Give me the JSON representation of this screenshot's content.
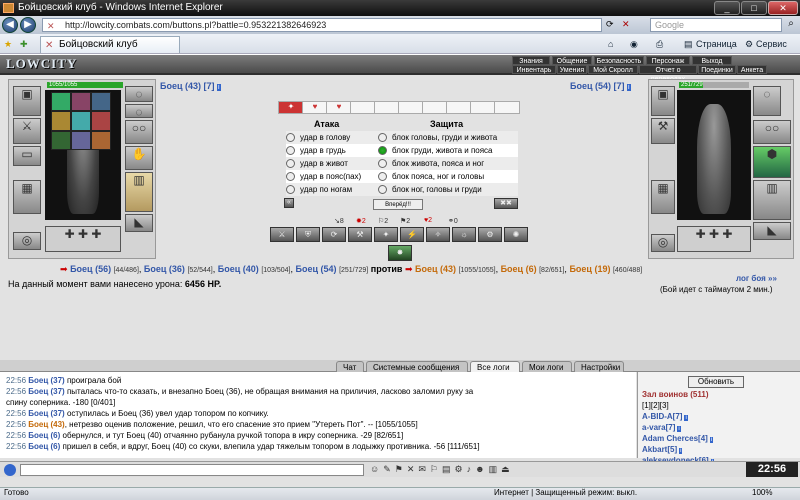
{
  "window": {
    "title": "Бойцовский клуб - Windows Internet Explorer"
  },
  "addressbar": {
    "url": "http://lowcity.combats.com/buttons.pl?battle=0.953221382646923",
    "search_placeholder": "Google"
  },
  "browser_tab": {
    "title": "Бойцовский клуб"
  },
  "commandbar": {
    "page_label": "Страница",
    "tools_label": "Сервис"
  },
  "game_header": {
    "logo": "LOWCITY",
    "menu_top": [
      "Знания",
      "Общение",
      "Безопасность",
      "Персонаж",
      "Выход"
    ],
    "menu_bottom": [
      "Инвентарь",
      "Умения",
      "Мой Скролл",
      "Отчет о переводах",
      "Поединки",
      "Анкета"
    ]
  },
  "player_left": {
    "name": "Боец (43) [7]",
    "hp": "1055/1055"
  },
  "player_right": {
    "name": "Боец (54) [7]",
    "hp": "251/729"
  },
  "combat": {
    "attack_title": "Атака",
    "defense_title": "Защита",
    "attacks": [
      "удар в голову",
      "удар в грудь",
      "удар в живот",
      "удар в пояс(пах)",
      "удар по ногам"
    ],
    "defenses": [
      "блок головы, груди и живота",
      "блок груди, живота и пояса",
      "блок живота, пояса и ног",
      "блок пояса, ног и головы",
      "блок ног, головы и груди"
    ],
    "selected_defense": 1,
    "submit_label": "Вперёд!!!",
    "stats": [
      "8",
      "2",
      "2",
      "2",
      "2",
      "0"
    ]
  },
  "teams": {
    "left": [
      {
        "name": "Боец (56)",
        "hp": "[44/486]"
      },
      {
        "name": "Боец (36)",
        "hp": "[52/544]"
      },
      {
        "name": "Боец (40)",
        "hp": "[103/504]"
      },
      {
        "name": "Боец (54)",
        "hp": "[251/729]"
      }
    ],
    "vs_label": "против",
    "right": [
      {
        "name": "Боец (43)",
        "hp": "[1055/1055]"
      },
      {
        "name": "Боец (6)",
        "hp": "[82/651]"
      },
      {
        "name": "Боец (19)",
        "hp": "[460/488]"
      }
    ]
  },
  "damage_text": "На данный момент вами нанесено урона:",
  "damage_value": "6456 HP.",
  "log_link": "лог боя »»",
  "timeout_text": "(Бой идет с таймаутом 2 мин.)",
  "chat_tabs": [
    "Чат",
    "Системные сообщения",
    "Все логи",
    "Мои логи",
    "Настройки"
  ],
  "chat_log": [
    {
      "time": "22:56",
      "html_a": "Боец (37)",
      "text": " проиграла бой"
    },
    {
      "time": "22:56",
      "html_a": "Боец (37)",
      "text": " пыталась что-то сказать, и внезапно Боец (36), не обращая внимания на приличия, ласково заломил руку за"
    },
    {
      "time": "",
      "html_a": "",
      "text": "спину соперника. -180 [0/401]"
    },
    {
      "time": "22:56",
      "html_a": "Боец (37)",
      "text": " оступилась и Боец (36) увел удар топором по копчику."
    },
    {
      "time": "22:56",
      "html_a": "Боец (43)",
      "text": ", нетрезво оценив положение, решил, что его спасение это прием \"Утереть Пот\". -- [1055/1055]"
    },
    {
      "time": "22:56",
      "html_a": "Боец (6)",
      "text": " обернулся, и тут Боец (40) отчаянно рубанула ручкой топора в икру соперника. -29 [82/651]"
    },
    {
      "time": "22:56",
      "html_a": "Боец (6)",
      "text": " пришел в себя, и вдруг, Боец (40) со скуки, влепила удар тяжелым топором в лодыжку противника. -56 [111/651]"
    }
  ],
  "right_panel": {
    "refresh_label": "Обновить",
    "room_title": "Зал воинов (511)",
    "pages": "[1][2][3]",
    "users": [
      "A-BID-A[7]",
      "a-vara[7]",
      "Adam Cherces[4]",
      "Akbart[5]",
      "aleksevdoneck[6]"
    ]
  },
  "clock": "22:56",
  "statusbar": {
    "left": "Готово",
    "zone": "Интернет | Защищенный режим: выкл.",
    "zoom": "100%"
  }
}
